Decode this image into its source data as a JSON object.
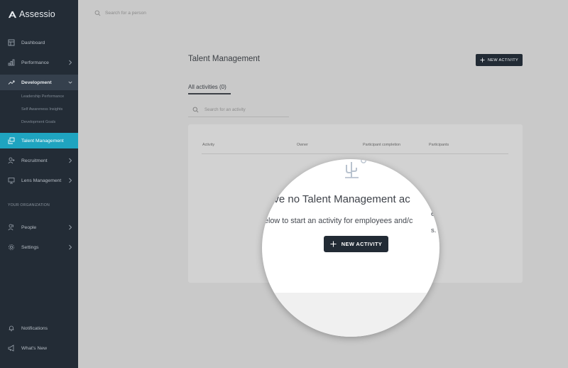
{
  "brand": {
    "name": "Assessio"
  },
  "search": {
    "placeholder": "Search for a person"
  },
  "sidebar": {
    "items": [
      {
        "label": "Dashboard",
        "icon": "dashboard-icon"
      },
      {
        "label": "Performance",
        "icon": "bar-chart-icon"
      },
      {
        "label": "Development",
        "icon": "trend-icon"
      },
      {
        "label": "Talent Management",
        "icon": "layers-icon"
      },
      {
        "label": "Recruitment",
        "icon": "user-plus-icon"
      },
      {
        "label": "Lens Management",
        "icon": "monitor-icon"
      }
    ],
    "development_sub": [
      "Leadership Performance",
      "Self Awareness Insights",
      "Development Goals"
    ],
    "section_label": "YOUR ORGANIZATION",
    "org_items": [
      {
        "label": "People",
        "icon": "users-icon"
      },
      {
        "label": "Settings",
        "icon": "gear-icon"
      }
    ],
    "bottom_items": [
      {
        "label": "Notifications",
        "icon": "bell-icon"
      },
      {
        "label": "What's New",
        "icon": "megaphone-icon"
      }
    ]
  },
  "main": {
    "title": "Talent Management",
    "new_activity_label": "NEW ACTIVITY",
    "tab_label": "All activities (0)",
    "activity_search_placeholder": "Search for an activity",
    "columns": [
      "Activity",
      "Owner",
      "Participant completion",
      "Participants"
    ],
    "empty": {
      "title": "ave no Talent Management ac",
      "subtitle": "elow to start an activity for employees and/c",
      "peek_right_1": "et",
      "peek_right_2": "s.",
      "button_label": "NEW ACTIVITY"
    }
  },
  "colors": {
    "sidebar_bg": "#232c36",
    "active_item": "#1fa4c0",
    "button_dark": "#222b35",
    "page_bg": "#c9c9c9"
  }
}
